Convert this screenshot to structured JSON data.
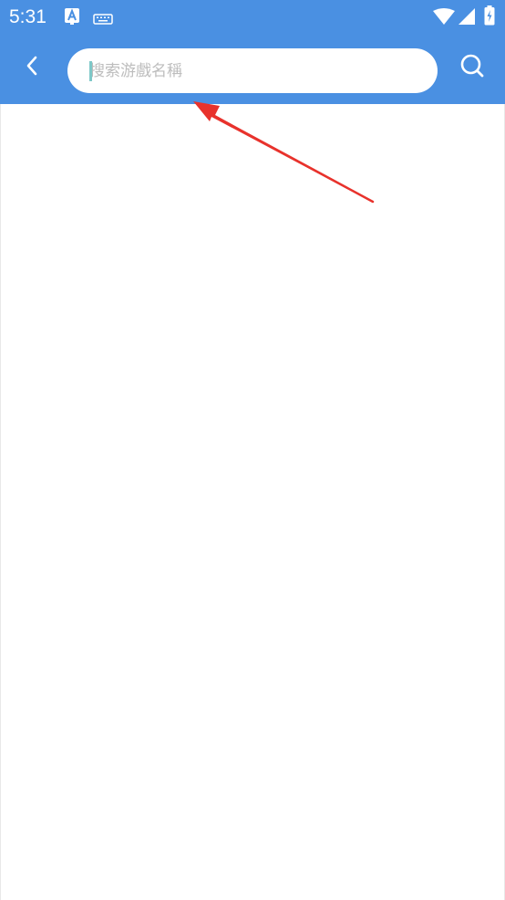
{
  "status_bar": {
    "time": "5:31",
    "icons": [
      "a11y-icon",
      "keyboard-icon",
      "wifi-icon",
      "signal-icon",
      "battery-icon"
    ]
  },
  "app_bar": {
    "background_color": "#4a90e2",
    "back_icon": "chevron-left-icon",
    "search": {
      "placeholder": "搜索游戲名稱",
      "value": ""
    },
    "search_icon": "search-icon"
  },
  "annotation": {
    "type": "red-arrow",
    "color": "#e8322c",
    "points_to": "search-input"
  }
}
